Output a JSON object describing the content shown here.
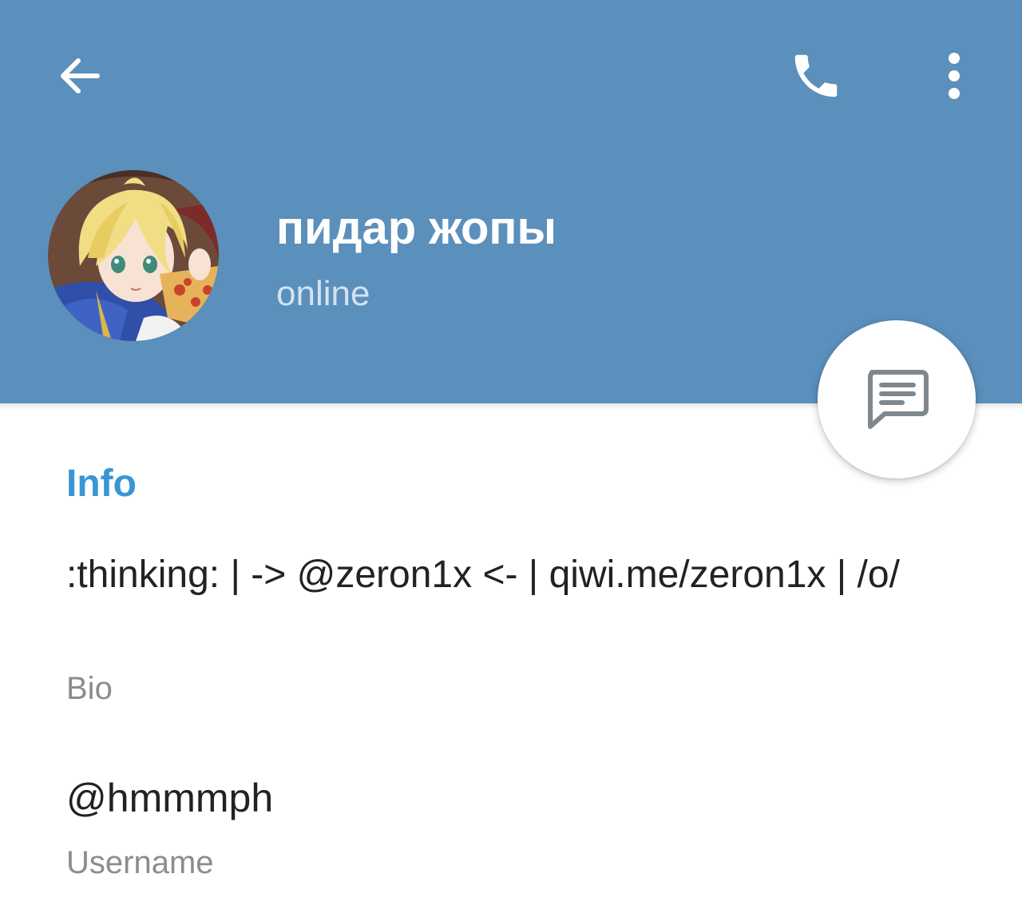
{
  "toolbar": {
    "back_icon": "arrow-left-icon",
    "call_icon": "phone-icon",
    "more_icon": "more-vertical-icon"
  },
  "profile": {
    "name": "пидар жопы",
    "status": "online",
    "avatar_icon": "anime-avatar-image"
  },
  "fab": {
    "icon": "message-icon"
  },
  "info": {
    "section_title": "Info",
    "bio": ":thinking: | -> @zeron1x <- | qiwi.me/zeron1x | /o/",
    "bio_label": "Bio",
    "username": "@hmmmph",
    "username_label": "Username"
  },
  "colors": {
    "header": "#5b8fbc",
    "accent": "#3a95d5",
    "status_text": "#d4e3f1"
  }
}
